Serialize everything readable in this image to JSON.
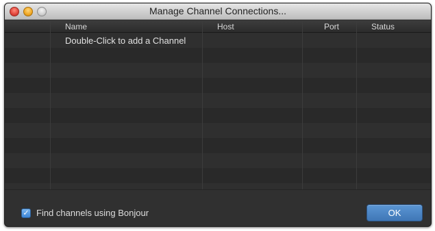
{
  "window": {
    "title": "Manage Channel Connections..."
  },
  "table": {
    "columns": [
      "Name",
      "Host",
      "Port",
      "Status"
    ],
    "placeholder_row": "Double-Click to add a Channel"
  },
  "footer": {
    "bonjour_checkbox_label": "Find channels using Bonjour",
    "bonjour_checked": true,
    "ok_label": "OK"
  },
  "colors": {
    "window_bg": "#303030",
    "accent_blue": "#4a86c8"
  }
}
